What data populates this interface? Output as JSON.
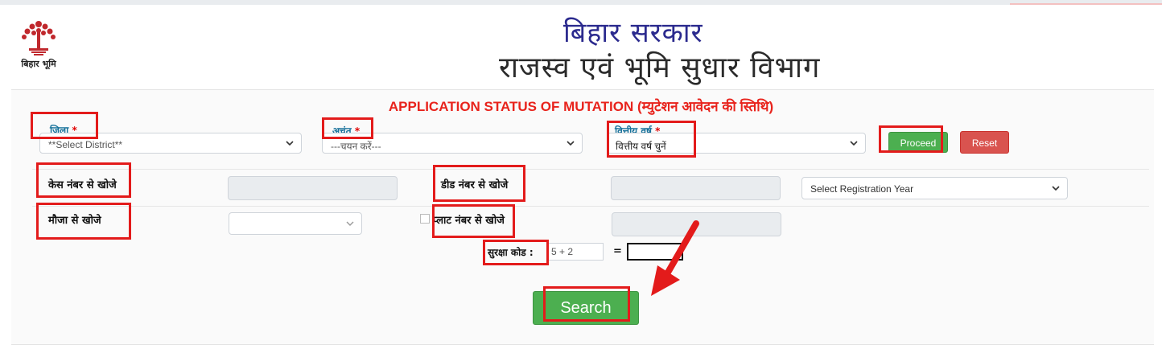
{
  "header": {
    "gov_title": "बिहार सरकार",
    "dept_title": "राजस्व एवं भूमि सुधार विभाग",
    "logo_text": "बिहार भूमि"
  },
  "form": {
    "heading": "APPLICATION STATUS OF MUTATION (म्युटेशन आवेदन की स्तिथि)",
    "district": {
      "label": "जिला",
      "required": "*",
      "selected": "**Select District**"
    },
    "circle": {
      "label": "अचंत",
      "required": "*",
      "selected": "---चयन करें---"
    },
    "fin_year": {
      "label": "वित्तीय वर्ष",
      "required": "*",
      "selected": "वित्तीय वर्ष चुनें"
    },
    "proceed_label": "Proceed",
    "reset_label": "Reset",
    "case_search_label": "केस नंबर से खोजे",
    "deed_search_label": "डीड नंबर से खोजे",
    "registration_year": "Select Registration Year",
    "mauza_search_label": "मौजा से खोजे",
    "plot_search_label": "प्लाट नंबर से खोजे",
    "captcha_label": "सुरक्षा कोड :",
    "captcha_question": "5 + 2",
    "captcha_equals": "=",
    "search_label": "Search"
  },
  "colors": {
    "heading": "#e8231c",
    "label": "#16719a",
    "proceed": "#4caf50",
    "reset": "#d9534f",
    "highlight": "#e31b1b"
  }
}
